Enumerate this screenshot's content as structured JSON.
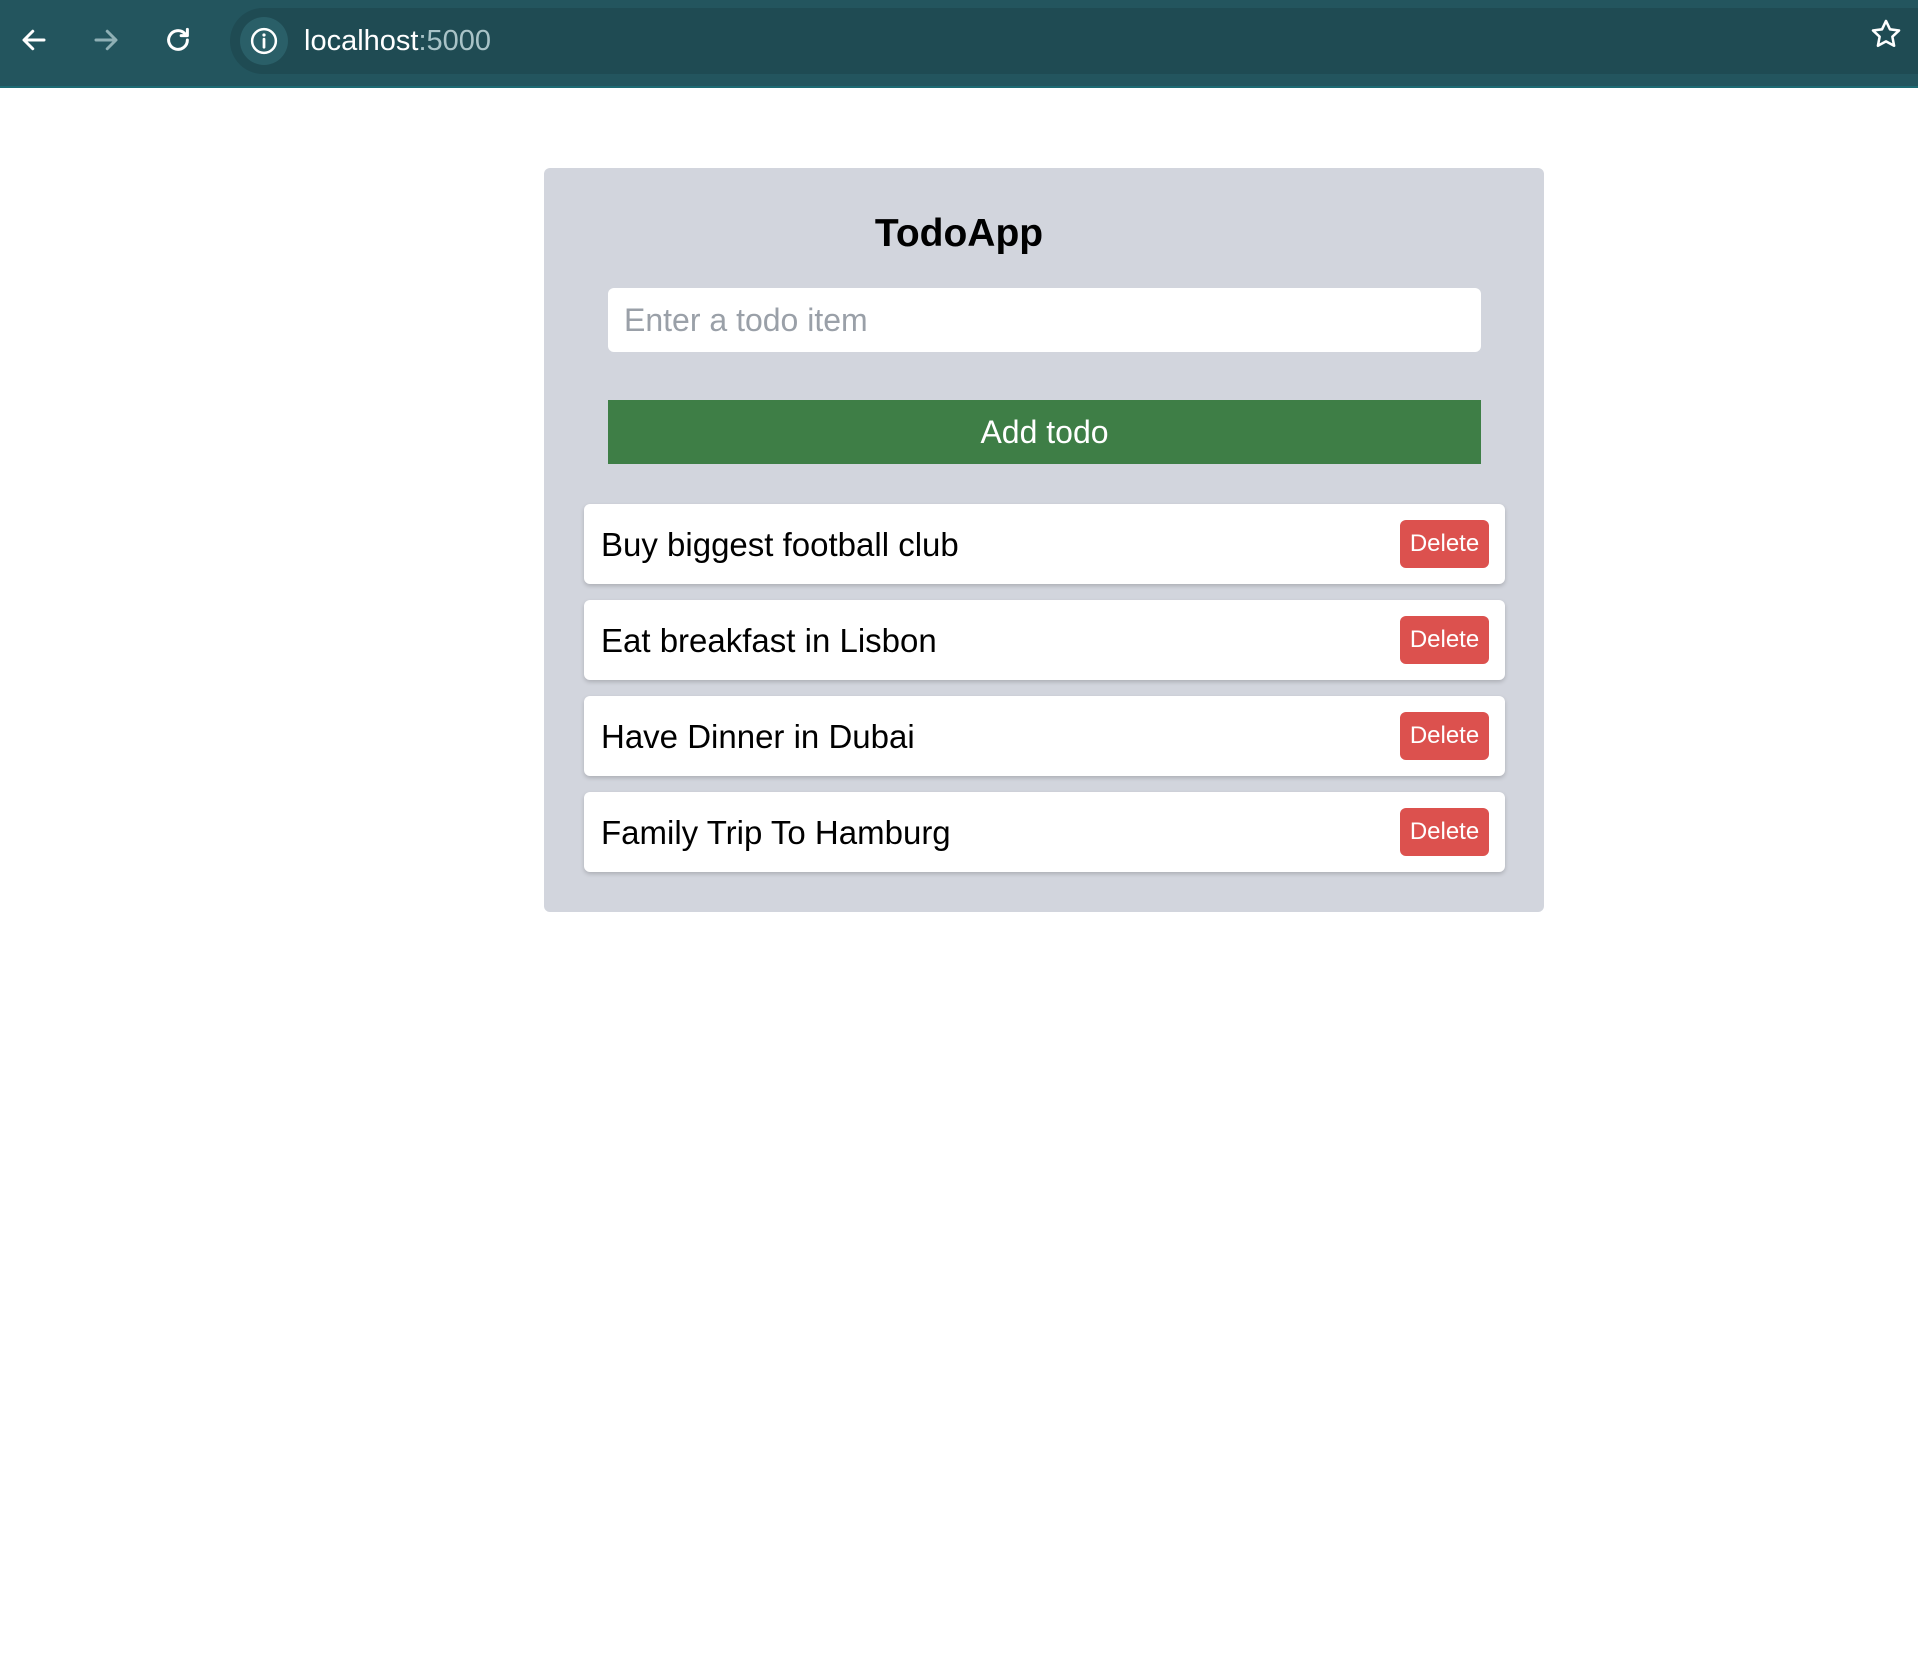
{
  "browser": {
    "url_host": "localhost",
    "url_port": ":5000",
    "icons": {
      "back": "arrow-left-icon",
      "forward": "arrow-right-icon",
      "reload": "reload-icon",
      "site_info": "info-icon",
      "bookmark": "star-icon"
    },
    "colors": {
      "toolbar": "#23555e",
      "omnibox": "#1f4b53"
    }
  },
  "app": {
    "title": "TodoApp",
    "input": {
      "placeholder": "Enter a todo item",
      "value": ""
    },
    "add_button_label": "Add todo",
    "todos": [
      {
        "text": "Buy biggest football club",
        "delete_label": "Delete"
      },
      {
        "text": "Eat breakfast in Lisbon",
        "delete_label": "Delete"
      },
      {
        "text": "Have Dinner in Dubai",
        "delete_label": "Delete"
      },
      {
        "text": "Family Trip To Hamburg",
        "delete_label": "Delete"
      }
    ],
    "colors": {
      "card_background": "#d2d5dd",
      "add_button": "#3e7e46",
      "delete_button": "#dc514e"
    }
  }
}
